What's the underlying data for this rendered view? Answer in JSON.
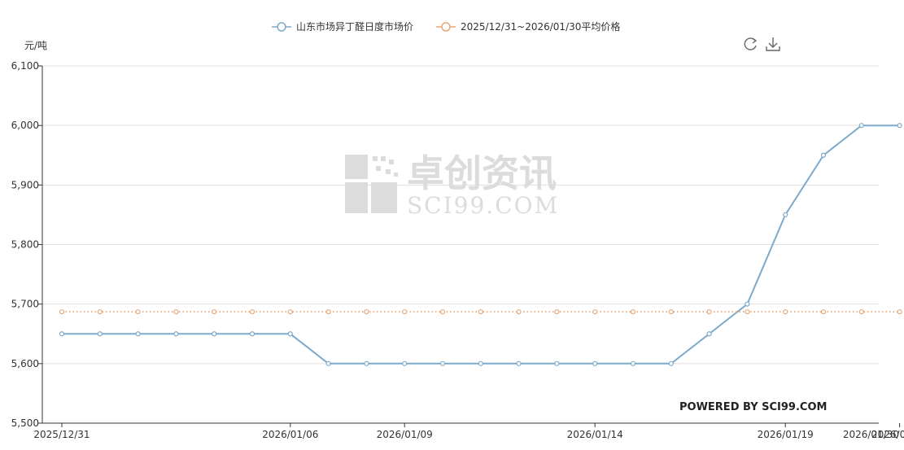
{
  "chart_data": {
    "type": "line",
    "ylabel": "元/吨",
    "ylim": [
      5500,
      6100
    ],
    "yticks": [
      5500,
      5600,
      5700,
      5800,
      5900,
      6000,
      6100
    ],
    "ytick_labels": [
      "5,500",
      "5,600",
      "5,700",
      "5,800",
      "5,900",
      "6,000",
      "6,100"
    ],
    "x": [
      "2025/12/31",
      "2026/01/01",
      "2026/01/02",
      "2026/01/03",
      "2026/01/04",
      "2026/01/05",
      "2026/01/06",
      "2026/01/07",
      "2026/01/08",
      "2026/01/09",
      "2026/01/10",
      "2026/01/11",
      "2026/01/12",
      "2026/01/13",
      "2026/01/14",
      "2026/01/15",
      "2026/01/16",
      "2026/01/17",
      "2026/01/18",
      "2026/01/19",
      "2026/01/20",
      "2026/01/21",
      "2026/01/22"
    ],
    "xtick_labels": [
      "2025/12/31",
      "2026/01/06",
      "2026/01/09",
      "2026/01/14",
      "2026/01/19",
      "2026/01/22",
      "2026/01/27",
      "2026/01/30"
    ],
    "grid": true,
    "legend_position": "top-center",
    "series": [
      {
        "name": "山东市场异丁醛日度市场价",
        "color": "#7eaacb",
        "values": [
          5650,
          5650,
          5650,
          5650,
          5650,
          5650,
          5650,
          5600,
          5600,
          5600,
          5600,
          5600,
          5600,
          5600,
          5600,
          5600,
          5600,
          5650,
          5700,
          5850,
          5950,
          6000,
          6000
        ]
      },
      {
        "name": "2025/12/31~2026/01/30平均价格",
        "color": "#e8a878",
        "style": "dotted",
        "values": [
          5687,
          5687,
          5687,
          5687,
          5687,
          5687,
          5687,
          5687,
          5687,
          5687,
          5687,
          5687,
          5687,
          5687,
          5687,
          5687,
          5687,
          5687,
          5687,
          5687,
          5687,
          5687,
          5687
        ]
      }
    ]
  },
  "watermark": {
    "cn": "卓创资讯",
    "en": "SCI99.COM"
  },
  "powered_by": "POWERED BY SCI99.COM",
  "toolbar": {
    "refresh_icon": "refresh-icon",
    "download_icon": "download-icon"
  },
  "colors": {
    "grid": "#e0e0e0",
    "axis": "#333333"
  }
}
